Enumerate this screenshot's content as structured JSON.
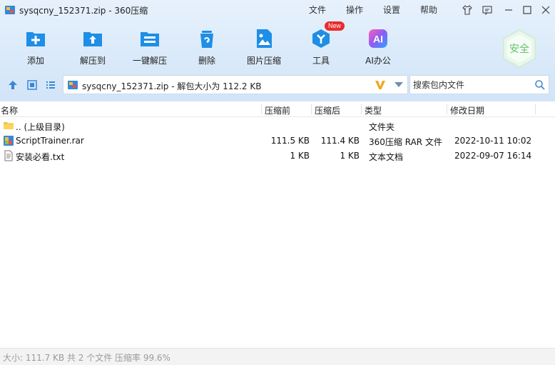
{
  "window": {
    "title": "sysqcny_152371.zip - 360压缩",
    "menu": [
      "文件",
      "操作",
      "设置",
      "帮助"
    ]
  },
  "toolbar": {
    "buttons": [
      {
        "label": "添加",
        "icon": "add-icon"
      },
      {
        "label": "解压到",
        "icon": "extract-to-icon"
      },
      {
        "label": "一键解压",
        "icon": "one-click-extract-icon"
      },
      {
        "label": "删除",
        "icon": "delete-icon"
      },
      {
        "label": "图片压缩",
        "icon": "image-compress-icon"
      },
      {
        "label": "工具",
        "icon": "tools-icon",
        "badge": "New"
      },
      {
        "label": "AI办公",
        "icon": "ai-office-icon",
        "icon_text": "AI"
      }
    ],
    "safe_badge": "安全"
  },
  "address": {
    "path": "sysqcny_152371.zip - 解包大小为 112.2 KB"
  },
  "search": {
    "placeholder": "搜索包内文件"
  },
  "columns": {
    "name": "名称",
    "compressed_before": "压缩前",
    "compressed_after": "压缩后",
    "type": "类型",
    "modified": "修改日期"
  },
  "files": [
    {
      "name": ".. (上级目录)",
      "before": "",
      "after": "",
      "type": "文件夹",
      "modified": "",
      "icon": "folder-icon"
    },
    {
      "name": "ScriptTrainer.rar",
      "before": "111.5 KB",
      "after": "111.4 KB",
      "type": "360压缩 RAR 文件",
      "modified": "2022-10-11 10:02",
      "icon": "rar-archive-icon"
    },
    {
      "name": "安装必看.txt",
      "before": "1 KB",
      "after": "1 KB",
      "type": "文本文档",
      "modified": "2022-09-07 16:14",
      "icon": "text-file-icon"
    }
  ],
  "status": {
    "text": "大小: 111.7 KB 共 2 个文件 压缩率 99.6%"
  },
  "colors": {
    "accent": "#1e8ee6",
    "toolbar_bg": "#d7e8f9",
    "safe_green": "#5ec46a"
  }
}
